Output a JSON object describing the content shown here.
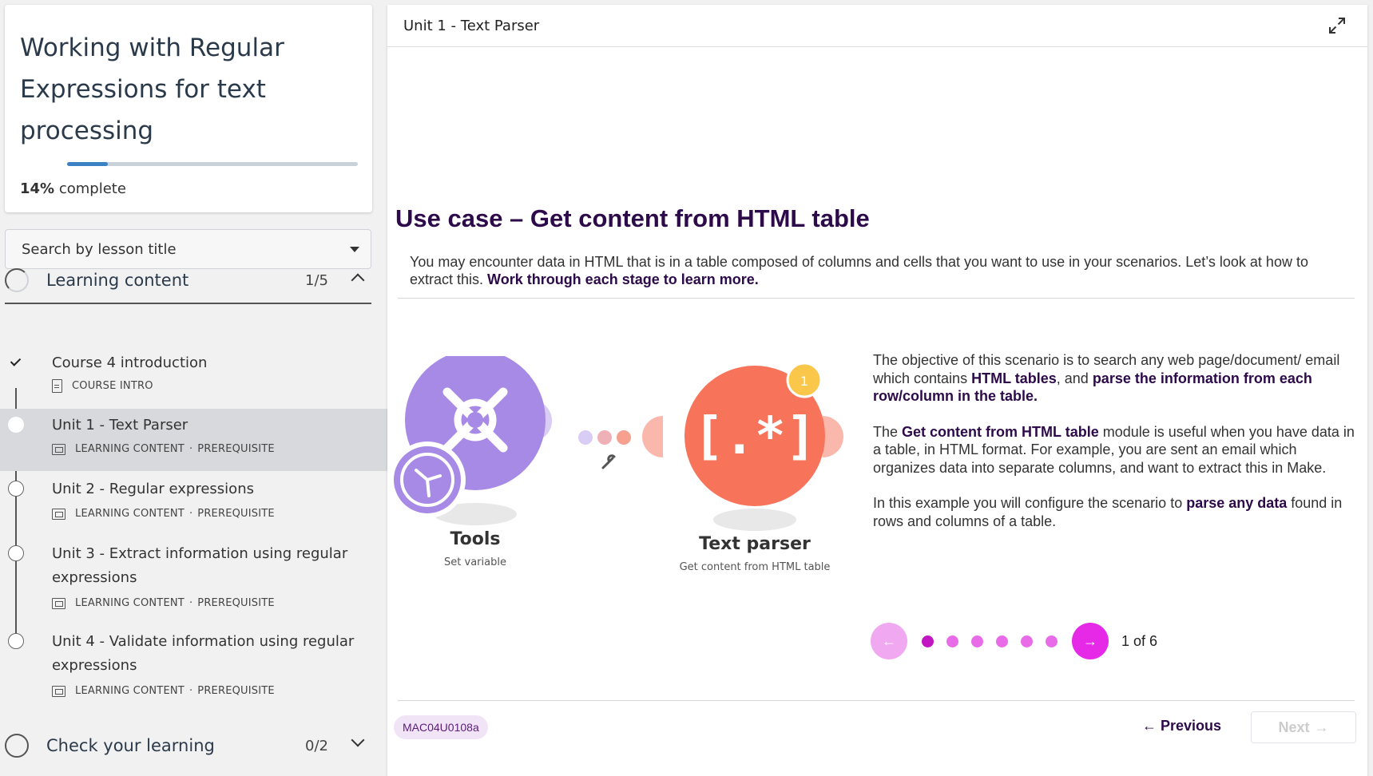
{
  "course": {
    "title": "Working with Regular Expressions for text processing",
    "progress_percent": 14,
    "progress_value": "14%",
    "progress_label": "complete"
  },
  "search": {
    "placeholder": "Search by lesson title"
  },
  "sections": [
    {
      "title": "Learning content",
      "count": "1/5",
      "expanded": true
    },
    {
      "title": "Check your learning",
      "count": "0/2",
      "expanded": false
    }
  ],
  "lessons": [
    {
      "title": "Course 4 introduction",
      "type": "COURSE INTRO",
      "tag": "",
      "status": "completed"
    },
    {
      "title": "Unit 1 - Text Parser",
      "type": "LEARNING CONTENT",
      "tag": "PREREQUISITE",
      "status": "current"
    },
    {
      "title": "Unit 2 - Regular expressions",
      "type": "LEARNING CONTENT",
      "tag": "PREREQUISITE",
      "status": "not-started"
    },
    {
      "title": "Unit 3 - Extract information using regular expressions",
      "type": "LEARNING CONTENT",
      "tag": "PREREQUISITE",
      "status": "not-started"
    },
    {
      "title": "Unit 4 - Validate information using regular expressions",
      "type": "LEARNING CONTENT",
      "tag": "PREREQUISITE",
      "status": "not-started"
    }
  ],
  "meta_separator": "·",
  "main": {
    "topbar_title": "Unit 1 - Text Parser",
    "heading": "Use case – Get content from HTML table",
    "intro_text": "You may encounter data in HTML that is in a table composed of columns and cells that you want to use in your scenarios. Let’s look at how to extract this. ",
    "intro_bold": "Work through each stage to learn more.",
    "diagram": {
      "module1_name": "Tools",
      "module1_action": "Set variable",
      "module2_name": "Text parser",
      "module2_action": "Get content from HTML table",
      "module2_badge": "1",
      "module2_symbol": "[.*]",
      "colors": {
        "tools": "#a789e6",
        "parser": "#f7735a",
        "badge": "#fac74a"
      }
    },
    "paragraphs": [
      {
        "parts": [
          {
            "t": "The objective of this scenario is to search any web page/document/ email which contains ",
            "b": false
          },
          {
            "t": "HTML tables",
            "b": true
          },
          {
            "t": ", and ",
            "b": false
          },
          {
            "t": "parse the information from each row/column in the table.",
            "b": true
          }
        ]
      },
      {
        "parts": [
          {
            "t": "The ",
            "b": false
          },
          {
            "t": "Get content from HTML table",
            "b": true
          },
          {
            "t": " module is useful when you have data in a table, in HTML format. For example, you are sent an email which organizes data into separate columns, and want to extract this in Make.",
            "b": false
          }
        ]
      },
      {
        "parts": [
          {
            "t": "In this example you will configure the scenario to ",
            "b": false
          },
          {
            "t": "parse any data",
            "b": true
          },
          {
            "t": " found in rows and columns of a table.",
            "b": false
          }
        ]
      }
    ],
    "pager": {
      "current": 1,
      "total": 6,
      "label": "1 of 6",
      "prev_arrow": "←",
      "next_arrow": "→"
    },
    "code": "MAC04U0108a",
    "previous_label": "Previous",
    "next_label": "Next",
    "previous_arrow": "←",
    "next_arrow": "→"
  },
  "colors": {
    "accent_magenta": "#e629e6",
    "heading_purple": "#2d0a4a",
    "progress_blue": "#3b82c4"
  }
}
